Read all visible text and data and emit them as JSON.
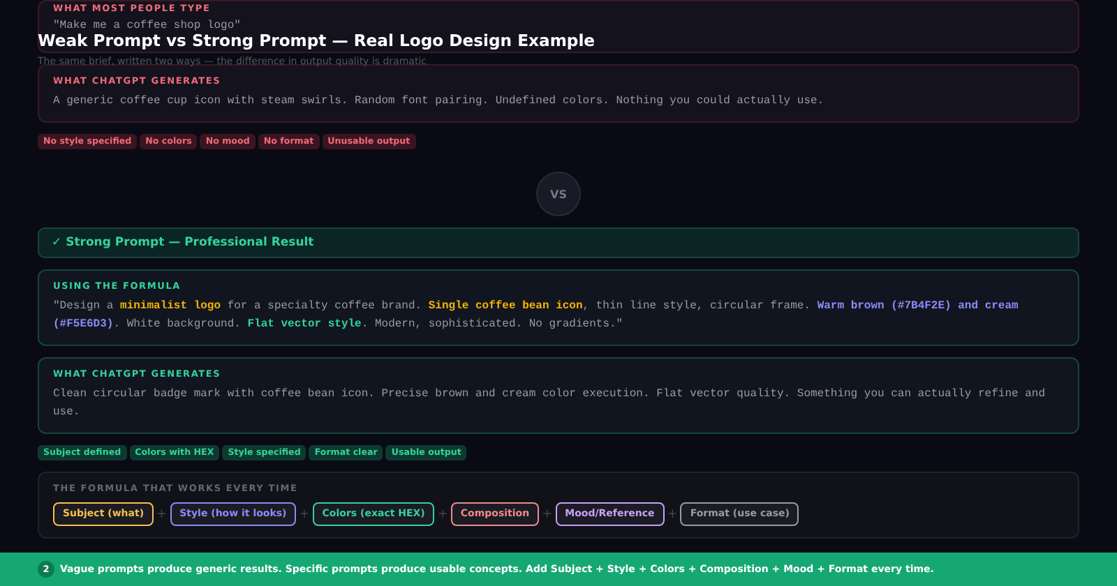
{
  "title": "Weak Prompt vs Strong Prompt — Real Logo Design Example",
  "subtitle": "The same brief, written two ways — the difference in output quality is dramatic",
  "weak": {
    "cards": [
      {
        "label": "WHAT MOST PEOPLE TYPE",
        "text": [
          {
            "kind": "plain",
            "text": "\"Make me a coffee shop logo\""
          }
        ]
      },
      {
        "label": "WHAT CHATGPT GENERATES",
        "text": [
          {
            "kind": "plain",
            "text": "A generic coffee cup icon with steam swirls. Random font pairing. Undefined colors. Nothing you could actually use."
          }
        ]
      }
    ],
    "tags": [
      "No style specified",
      "No colors",
      "No mood",
      "No format",
      "Unusable output"
    ]
  },
  "divider": "VS",
  "strong": {
    "header": "✓ Strong Prompt — Professional Result",
    "cards": [
      {
        "label": "USING THE FORMULA",
        "text": [
          {
            "kind": "plain",
            "text": "\"Design a "
          },
          {
            "kind": "subject",
            "text": "minimalist logo"
          },
          {
            "kind": "plain",
            "text": " for a specialty coffee brand. "
          },
          {
            "kind": "subject",
            "text": "Single coffee bean icon"
          },
          {
            "kind": "plain",
            "text": ", thin line style, circular frame. "
          },
          {
            "kind": "color",
            "text": "Warm brown (#7B4F2E) and cream (#F5E6D3)"
          },
          {
            "kind": "plain",
            "text": ". White background. "
          },
          {
            "kind": "style",
            "text": "Flat vector style"
          },
          {
            "kind": "plain",
            "text": ". Modern, sophisticated. No gradients.\""
          }
        ]
      },
      {
        "label": "WHAT CHATGPT GENERATES",
        "text": [
          {
            "kind": "plain",
            "text": "Clean circular badge mark with coffee bean icon. Precise brown and cream color execution. Flat vector quality. Something you can actually refine and use."
          }
        ]
      }
    ],
    "tags": [
      "Subject defined",
      "Colors with HEX",
      "Style specified",
      "Format clear",
      "Usable output"
    ]
  },
  "formula": {
    "title": "THE FORMULA THAT WORKS EVERY TIME",
    "parts": [
      {
        "label": "Subject (what)",
        "color": "#f5c04a"
      },
      {
        "joiner": "+",
        "label": "Style (how it looks)",
        "color": "#8b8cf8"
      },
      {
        "joiner": "+",
        "label": "Colors (exact HEX)",
        "color": "#34d399"
      },
      {
        "joiner": "+",
        "label": "Composition",
        "color": "#f08a8a"
      },
      {
        "joiner": "+",
        "label": "Mood/Reference",
        "color": "#c9a0f8"
      },
      {
        "joiner": "+",
        "label": "Format (use case)",
        "color": "#9a9aa5"
      }
    ]
  },
  "footer": {
    "badge": "2",
    "text": "Vague prompts produce generic results. Specific prompts produce usable concepts. Add Subject + Style + Colors + Composition + Mood + Format every time."
  }
}
